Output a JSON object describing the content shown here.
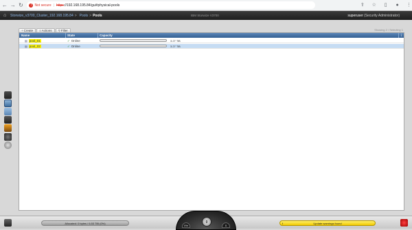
{
  "browser": {
    "back_icon": "back-arrow-icon",
    "security_label": "Not secure",
    "url_scheme": "https",
    "url_rest": "://192.168.195.84/gui#physical-pools"
  },
  "header": {
    "breadcrumb": [
      "Storwize_v3700_Cluster_192.168.195.84",
      "Pools",
      "Pools"
    ],
    "product": "IBM Storwize V3700",
    "user": "superuser",
    "role": "(Security Administrator)"
  },
  "toolbar": {
    "create": "Create",
    "actions": "Actions",
    "filter": "Filter",
    "showing": "Showing 2 / Selecting 1"
  },
  "grid": {
    "headers": [
      "Name",
      "State",
      "Capacity"
    ],
    "rows": [
      {
        "name": "pool_01",
        "state": "Online",
        "capacity_text": "3.27 TiB",
        "used_fraction": 0.0,
        "selected": false
      },
      {
        "name": "pool_02",
        "state": "Online",
        "capacity_text": "3.27 TiB",
        "used_fraction": 0.0,
        "selected": true
      }
    ]
  },
  "status": {
    "allocated": "Allocated: 0 bytes / 6.53 TiB (0%)",
    "dial_left": "0%",
    "dial_center": "0",
    "dial_right": "0",
    "alert": "Update warnings found"
  },
  "colors": {
    "header_blue": "#335f92",
    "highlight_yellow": "#fff200",
    "alert_yellow": "#f0c800"
  }
}
